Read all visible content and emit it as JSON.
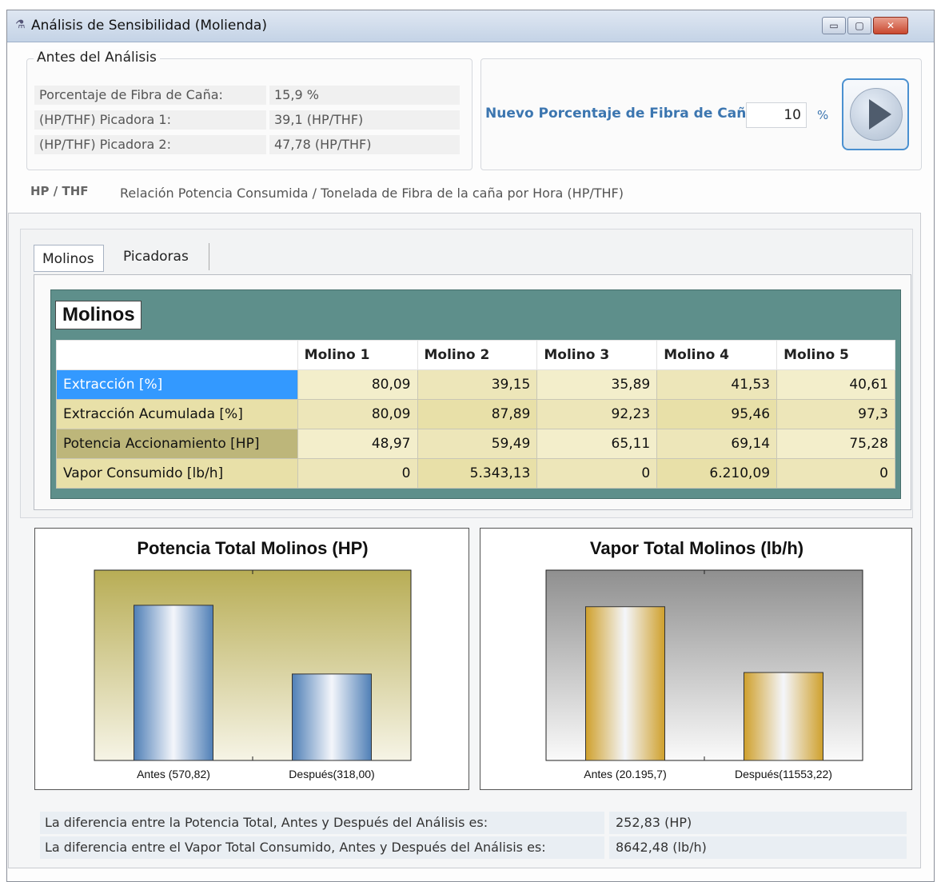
{
  "window": {
    "title": "Análisis de Sensibilidad (Molienda)",
    "min_label": "▭",
    "max_label": "▢",
    "close_label": "✕"
  },
  "before": {
    "legend": "Antes del Análisis",
    "rows": [
      {
        "label": "Porcentaje de Fibra de Caña:",
        "value": "15,9 %"
      },
      {
        "label": "(HP/THF) Picadora 1:",
        "value": "39,1  (HP/THF)"
      },
      {
        "label": "(HP/THF) Picadora 2:",
        "value": "47,78  (HP/THF)"
      }
    ]
  },
  "nuevo": {
    "label": "Nuevo Porcentaje de Fibra de Caña",
    "value": "10",
    "unit": "%"
  },
  "legend": {
    "abbr": "HP / THF",
    "text": "Relación Potencia Consumida / Tonelada de Fibra de la caña por Hora (HP/THF)"
  },
  "tabs": [
    {
      "label": "Molinos",
      "active": true
    },
    {
      "label": "Picadoras",
      "active": false
    }
  ],
  "grid": {
    "title": "Molinos",
    "columns": [
      "",
      "Molino 1",
      "Molino 2",
      "Molino 3",
      "Molino 4",
      "Molino 5"
    ],
    "rows": [
      {
        "label": "Extracción [%]",
        "values": [
          "80,09",
          "39,15",
          "35,89",
          "41,53",
          "40,61"
        ]
      },
      {
        "label": "Extracción Acumulada [%]",
        "values": [
          "80,09",
          "87,89",
          "92,23",
          "95,46",
          "97,3"
        ]
      },
      {
        "label": "Potencia Accionamiento [HP]",
        "values": [
          "48,97",
          "59,49",
          "65,11",
          "69,14",
          "75,28"
        ]
      },
      {
        "label": "Vapor Consumido [lb/h]",
        "values": [
          "0",
          "5.343,13",
          "0",
          "6.210,09",
          "0"
        ]
      }
    ],
    "colors": {
      "selected_label_bg": "#3399ff",
      "label_bg": "#e8e0a8",
      "dark_label_bg": "#bdb67a",
      "cell_bg": "#f3eecb",
      "cell_alt_bg": "#ede6b9"
    }
  },
  "chart_data": [
    {
      "type": "bar",
      "title": "Potencia Total Molinos (HP)",
      "categories": [
        "Antes (570,82)",
        "Después(318,00)"
      ],
      "values": [
        570.82,
        318.0
      ],
      "ylim": [
        0,
        700
      ],
      "grid": false,
      "colors": {
        "bar": "#4f7fb6",
        "plot_top": "#b8ad55",
        "plot_bottom": "#f6f4e6"
      }
    },
    {
      "type": "bar",
      "title": "Vapor Total Molinos (lb/h)",
      "categories": [
        "Antes (20.195,7)",
        "Después(11553,22)"
      ],
      "values": [
        20195.7,
        11553.22
      ],
      "ylim": [
        0,
        25000
      ],
      "grid": false,
      "colors": {
        "bar": "#cfa02c",
        "plot_top": "#8f8f8f",
        "plot_bottom": "#fafafa"
      }
    }
  ],
  "summary": [
    {
      "label": "La diferencia entre la Potencia Total,  Antes y Después del Análisis es:",
      "value": "252,83  (HP)"
    },
    {
      "label": "La diferencia entre el Vapor Total Consumido,  Antes y Después del Análisis es:",
      "value": "8642,48  (lb/h)"
    }
  ]
}
